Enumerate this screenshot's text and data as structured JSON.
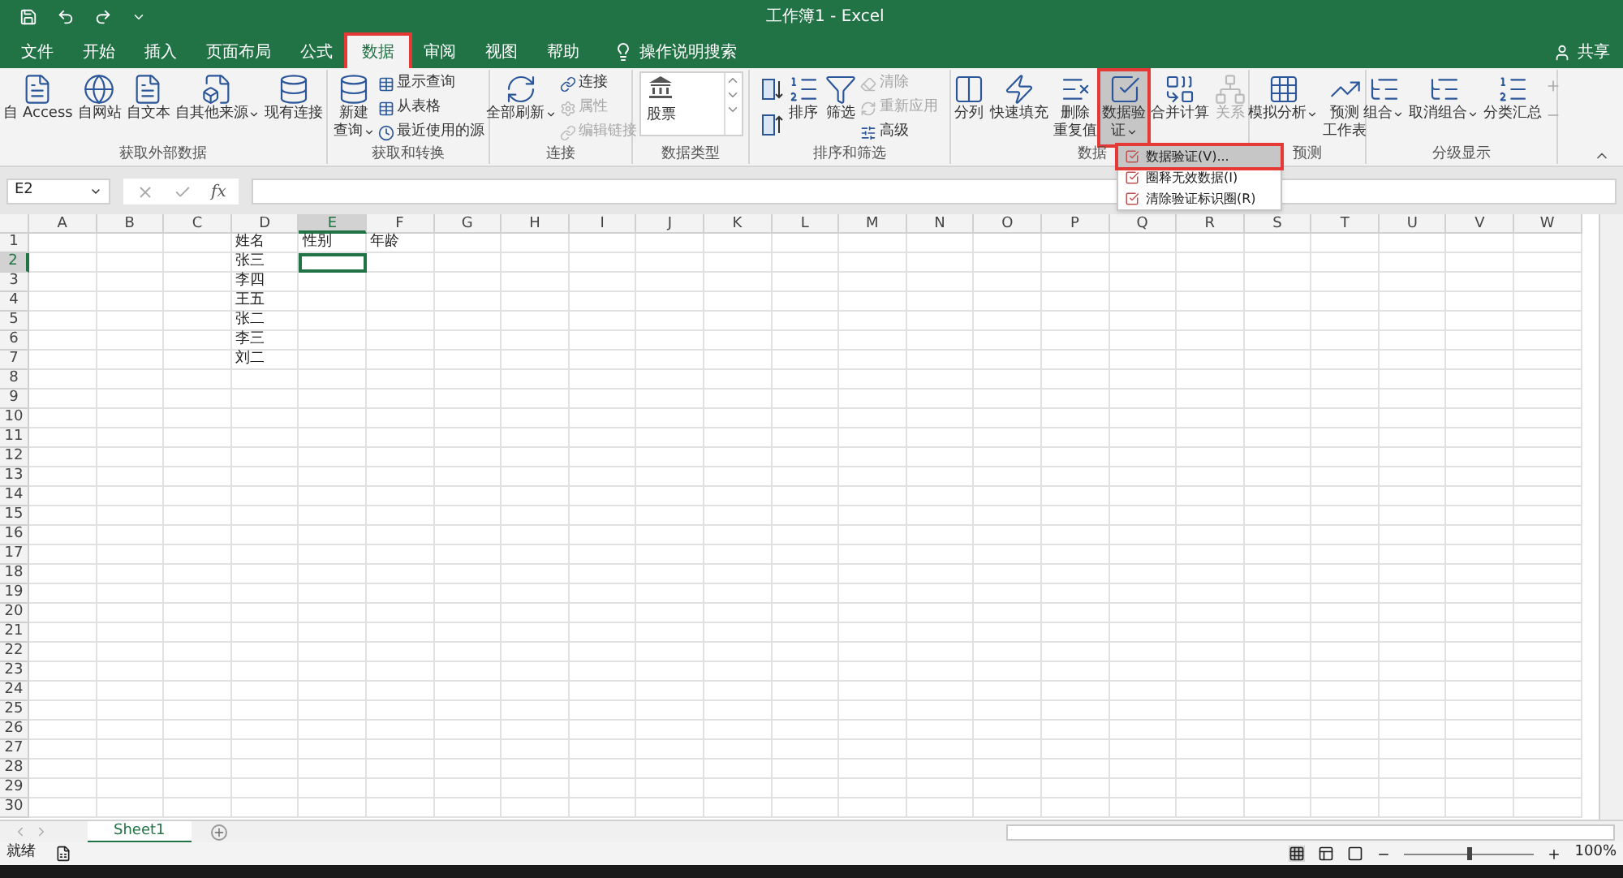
{
  "title_bar": {
    "title": "工作簿1 - Excel"
  },
  "tabs": [
    {
      "label": "文件",
      "selected": false,
      "highlighted": false
    },
    {
      "label": "开始",
      "selected": false,
      "highlighted": false
    },
    {
      "label": "插入",
      "selected": false,
      "highlighted": false
    },
    {
      "label": "页面布局",
      "selected": false,
      "highlighted": false
    },
    {
      "label": "公式",
      "selected": false,
      "highlighted": false
    },
    {
      "label": "数据",
      "selected": true,
      "highlighted": true
    },
    {
      "label": "审阅",
      "selected": false,
      "highlighted": false
    },
    {
      "label": "视图",
      "selected": false,
      "highlighted": false
    },
    {
      "label": "帮助",
      "selected": false,
      "highlighted": false
    }
  ],
  "tell_me": {
    "placeholder": "操作说明搜索"
  },
  "share": {
    "label": "共享"
  },
  "ribbon_groups": [
    {
      "title": "获取外部数据",
      "buttons": [
        {
          "kind": "large",
          "lines": [
            "自 Access"
          ],
          "caret": false,
          "disabled": false,
          "highlighted": false
        },
        {
          "kind": "large",
          "lines": [
            "自网站"
          ],
          "caret": false,
          "disabled": false,
          "highlighted": false
        },
        {
          "kind": "large",
          "lines": [
            "自文本"
          ],
          "caret": false,
          "disabled": false,
          "highlighted": false
        },
        {
          "kind": "large",
          "lines": [
            "自其他来源"
          ],
          "caret": true,
          "disabled": false,
          "highlighted": false
        },
        {
          "kind": "large",
          "lines": [
            "现有连接"
          ],
          "caret": false,
          "disabled": false,
          "highlighted": false
        }
      ]
    },
    {
      "title": "获取和转换",
      "buttons": [
        {
          "kind": "large",
          "lines": [
            "新建",
            "查询"
          ],
          "caret": true,
          "disabled": false,
          "highlighted": false
        },
        {
          "kind": "small",
          "lines": [
            "显示查询"
          ],
          "caret": false,
          "disabled": false,
          "highlighted": false
        },
        {
          "kind": "small",
          "lines": [
            "从表格"
          ],
          "caret": false,
          "disabled": false,
          "highlighted": false
        },
        {
          "kind": "small",
          "lines": [
            "最近使用的源"
          ],
          "caret": false,
          "disabled": false,
          "highlighted": false
        }
      ]
    },
    {
      "title": "连接",
      "buttons": [
        {
          "kind": "large",
          "lines": [
            "全部刷新"
          ],
          "caret": true,
          "disabled": false,
          "highlighted": false
        },
        {
          "kind": "small",
          "lines": [
            "连接"
          ],
          "caret": false,
          "disabled": false,
          "highlighted": false
        },
        {
          "kind": "small",
          "lines": [
            "属性"
          ],
          "caret": false,
          "disabled": true,
          "highlighted": false
        },
        {
          "kind": "small",
          "lines": [
            "编辑链接"
          ],
          "caret": false,
          "disabled": true,
          "highlighted": false
        }
      ]
    },
    {
      "title": "数据类型",
      "buttons": [
        {
          "kind": "gallery",
          "lines": [
            "股票"
          ],
          "disabled": false,
          "highlighted": false
        }
      ]
    },
    {
      "title": "排序和筛选",
      "buttons": [
        {
          "kind": "sortpair",
          "disabled": false,
          "highlighted": false
        },
        {
          "kind": "large",
          "lines": [
            "排序"
          ],
          "caret": false,
          "disabled": false,
          "highlighted": false
        },
        {
          "kind": "large",
          "lines": [
            "筛选"
          ],
          "caret": false,
          "disabled": false,
          "highlighted": false
        },
        {
          "kind": "small",
          "lines": [
            "清除"
          ],
          "caret": false,
          "disabled": true,
          "highlighted": false
        },
        {
          "kind": "small",
          "lines": [
            "重新应用"
          ],
          "caret": false,
          "disabled": true,
          "highlighted": false
        },
        {
          "kind": "small",
          "lines": [
            "高级"
          ],
          "caret": false,
          "disabled": false,
          "highlighted": false
        }
      ]
    },
    {
      "title": "数据",
      "buttons": [
        {
          "kind": "large",
          "lines": [
            "分列"
          ],
          "caret": false,
          "disabled": false,
          "highlighted": false
        },
        {
          "kind": "large",
          "lines": [
            "快速填充"
          ],
          "caret": false,
          "disabled": false,
          "highlighted": false
        },
        {
          "kind": "large",
          "lines": [
            "删除",
            "重复值"
          ],
          "caret": false,
          "disabled": false,
          "highlighted": false
        },
        {
          "kind": "large",
          "lines": [
            "数据验",
            "证"
          ],
          "caret": true,
          "disabled": false,
          "highlighted": true
        },
        {
          "kind": "large",
          "lines": [
            "合并计算"
          ],
          "caret": false,
          "disabled": false,
          "highlighted": false
        },
        {
          "kind": "large",
          "lines": [
            "关系"
          ],
          "caret": false,
          "disabled": true,
          "highlighted": false
        }
      ]
    },
    {
      "title": "预测",
      "buttons": [
        {
          "kind": "large",
          "lines": [
            "模拟分析"
          ],
          "caret": true,
          "disabled": false,
          "highlighted": false
        },
        {
          "kind": "large",
          "lines": [
            "预测",
            "工作表"
          ],
          "caret": false,
          "disabled": false,
          "highlighted": false
        }
      ]
    },
    {
      "title": "分级显示",
      "buttons": [
        {
          "kind": "large",
          "lines": [
            "组合"
          ],
          "caret": true,
          "disabled": false,
          "highlighted": false
        },
        {
          "kind": "large",
          "lines": [
            "取消组合"
          ],
          "caret": true,
          "disabled": false,
          "highlighted": false
        },
        {
          "kind": "large",
          "lines": [
            "分类汇总"
          ],
          "caret": false,
          "disabled": false,
          "highlighted": false
        },
        {
          "kind": "smallicons",
          "disabled": true,
          "highlighted": false
        }
      ]
    }
  ],
  "dropdown_menu": {
    "items": [
      {
        "label": "数据验证(V)...",
        "selected": true,
        "highlighted": true
      },
      {
        "label": "圈释无效数据(I)",
        "selected": false,
        "highlighted": false
      },
      {
        "label": "清除验证标识圈(R)",
        "selected": false,
        "highlighted": false
      }
    ]
  },
  "name_box": {
    "value": "E2"
  },
  "formula_bar": {
    "fx": "fx"
  },
  "columns": [
    {
      "label": "A",
      "selected": false
    },
    {
      "label": "B",
      "selected": false
    },
    {
      "label": "C",
      "selected": false
    },
    {
      "label": "D",
      "selected": false
    },
    {
      "label": "E",
      "selected": true
    },
    {
      "label": "F",
      "selected": false
    },
    {
      "label": "G",
      "selected": false
    },
    {
      "label": "H",
      "selected": false
    },
    {
      "label": "I",
      "selected": false
    },
    {
      "label": "J",
      "selected": false
    },
    {
      "label": "K",
      "selected": false
    },
    {
      "label": "L",
      "selected": false
    },
    {
      "label": "M",
      "selected": false
    },
    {
      "label": "N",
      "selected": false
    },
    {
      "label": "O",
      "selected": false
    },
    {
      "label": "P",
      "selected": false
    },
    {
      "label": "Q",
      "selected": false
    },
    {
      "label": "R",
      "selected": false
    },
    {
      "label": "S",
      "selected": false
    },
    {
      "label": "T",
      "selected": false
    },
    {
      "label": "U",
      "selected": false
    },
    {
      "label": "V",
      "selected": false
    },
    {
      "label": "W",
      "selected": false
    }
  ],
  "rows": [
    {
      "number": "1",
      "selected": false
    },
    {
      "number": "2",
      "selected": true
    },
    {
      "number": "3",
      "selected": false
    },
    {
      "number": "4",
      "selected": false
    },
    {
      "number": "5",
      "selected": false
    },
    {
      "number": "6",
      "selected": false
    },
    {
      "number": "7",
      "selected": false
    },
    {
      "number": "8",
      "selected": false
    },
    {
      "number": "9",
      "selected": false
    },
    {
      "number": "10",
      "selected": false
    },
    {
      "number": "11",
      "selected": false
    },
    {
      "number": "12",
      "selected": false
    },
    {
      "number": "13",
      "selected": false
    },
    {
      "number": "14",
      "selected": false
    },
    {
      "number": "15",
      "selected": false
    },
    {
      "number": "16",
      "selected": false
    },
    {
      "number": "17",
      "selected": false
    },
    {
      "number": "18",
      "selected": false
    },
    {
      "number": "19",
      "selected": false
    },
    {
      "number": "20",
      "selected": false
    },
    {
      "number": "21",
      "selected": false
    },
    {
      "number": "22",
      "selected": false
    },
    {
      "number": "23",
      "selected": false
    },
    {
      "number": "24",
      "selected": false
    },
    {
      "number": "25",
      "selected": false
    },
    {
      "number": "26",
      "selected": false
    },
    {
      "number": "27",
      "selected": false
    },
    {
      "number": "28",
      "selected": false
    },
    {
      "number": "29",
      "selected": false
    },
    {
      "number": "30",
      "selected": false
    }
  ],
  "table": {
    "rows": [
      [
        "姓名",
        "性别",
        "年龄"
      ],
      [
        "张三"
      ],
      [
        "李四"
      ],
      [
        "王五"
      ],
      [
        "张二"
      ],
      [
        "李三"
      ],
      [
        "刘二"
      ]
    ]
  },
  "sheet_tabs": [
    {
      "label": "Sheet1",
      "selected": true
    }
  ],
  "status_bar": {
    "status": "就绪",
    "zoom": "100%",
    "zoom_slider": {
      "level": 0.5
    }
  }
}
